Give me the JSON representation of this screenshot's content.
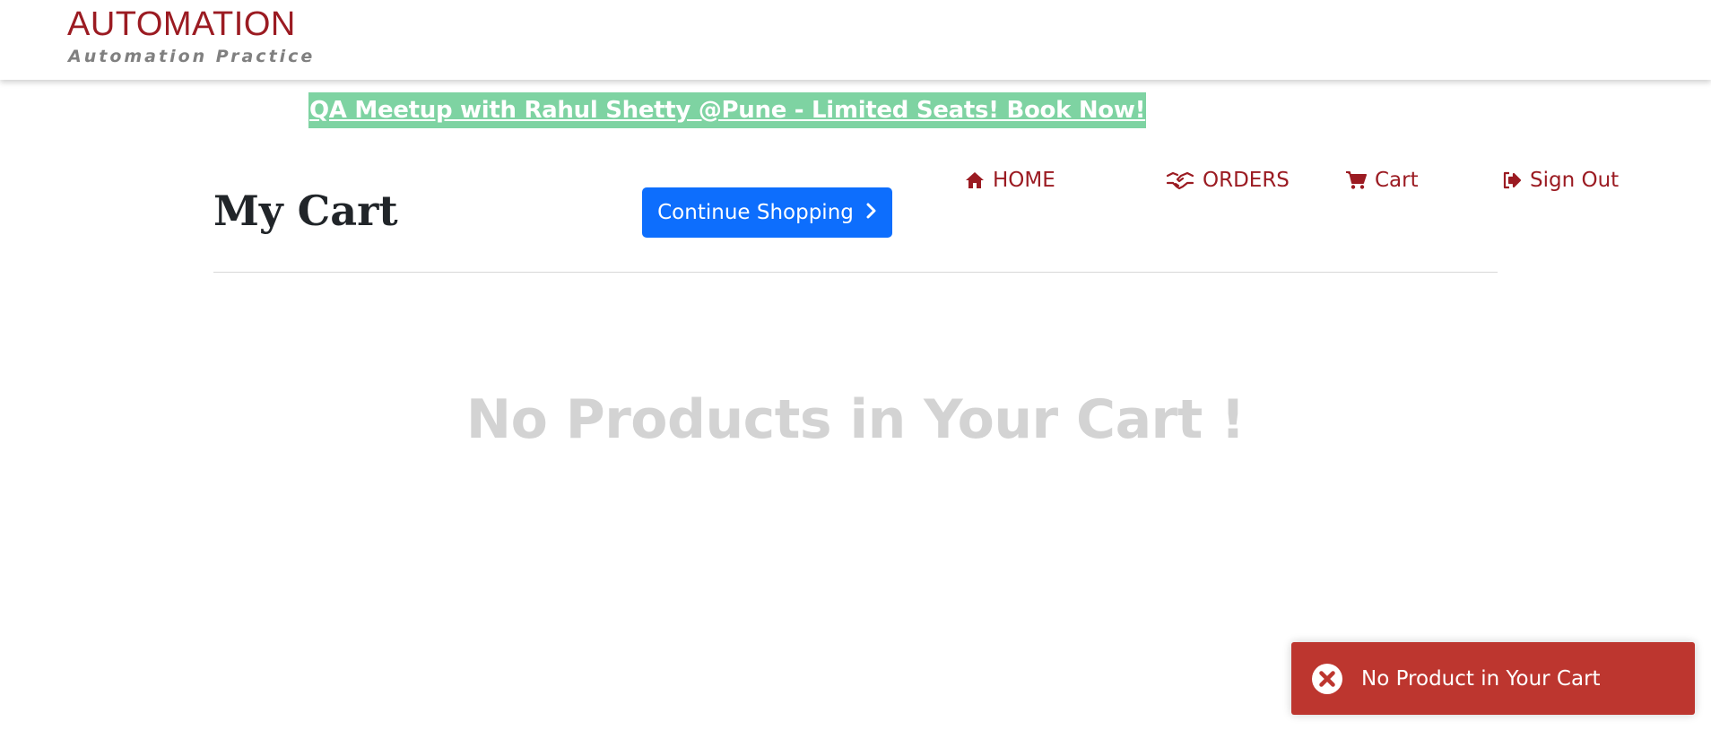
{
  "brand": {
    "title": "AUTOMATION",
    "subtitle": "Automation Practice",
    "color": "#9b1b22"
  },
  "promo": {
    "text": "QA Meetup with Rahul Shetty @Pune - Limited Seats! Book Now!",
    "background": "#7ed3a2"
  },
  "nav": {
    "items": [
      {
        "label": "HOME",
        "icon": "home-icon"
      },
      {
        "label": "ORDERS",
        "icon": "handshake-icon"
      },
      {
        "label": "Cart",
        "icon": "cart-icon"
      },
      {
        "label": "Sign Out",
        "icon": "sign-out-icon"
      }
    ]
  },
  "main": {
    "title": "My Cart",
    "continue_label": "Continue Shopping",
    "continue_icon": "chevron-right-icon",
    "empty_message": "No Products in Your Cart !"
  },
  "toast": {
    "message": "No Product in Your Cart",
    "icon": "error-icon",
    "color": "#bd362f"
  },
  "colors": {
    "accent": "#0d6efd"
  }
}
